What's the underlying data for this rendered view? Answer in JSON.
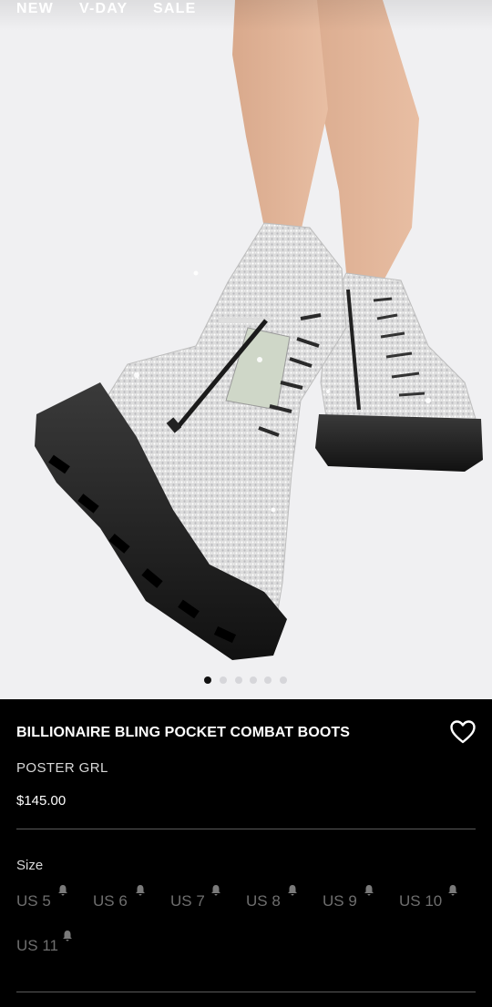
{
  "nav": {
    "items": [
      "NEW",
      "V-DAY",
      "SALE"
    ]
  },
  "gallery": {
    "image": "product-photo-rhinestone-combat-boots",
    "dot_count": 6,
    "active_index": 0
  },
  "product": {
    "title": "BILLIONAIRE BLING POCKET COMBAT BOOTS",
    "brand": "POSTER GRL",
    "price": "$145.00"
  },
  "size": {
    "label": "Size",
    "options": [
      "US 5",
      "US 6",
      "US 7",
      "US 8",
      "US 9",
      "US 10",
      "US 11"
    ],
    "notify_icon": "bell-icon"
  },
  "colors": {
    "hero_bg": "#f0f0f2",
    "panel_bg": "#000000",
    "text": "#ffffff",
    "muted_text": "#6e6e6e",
    "divider": "#5a5a5a"
  }
}
